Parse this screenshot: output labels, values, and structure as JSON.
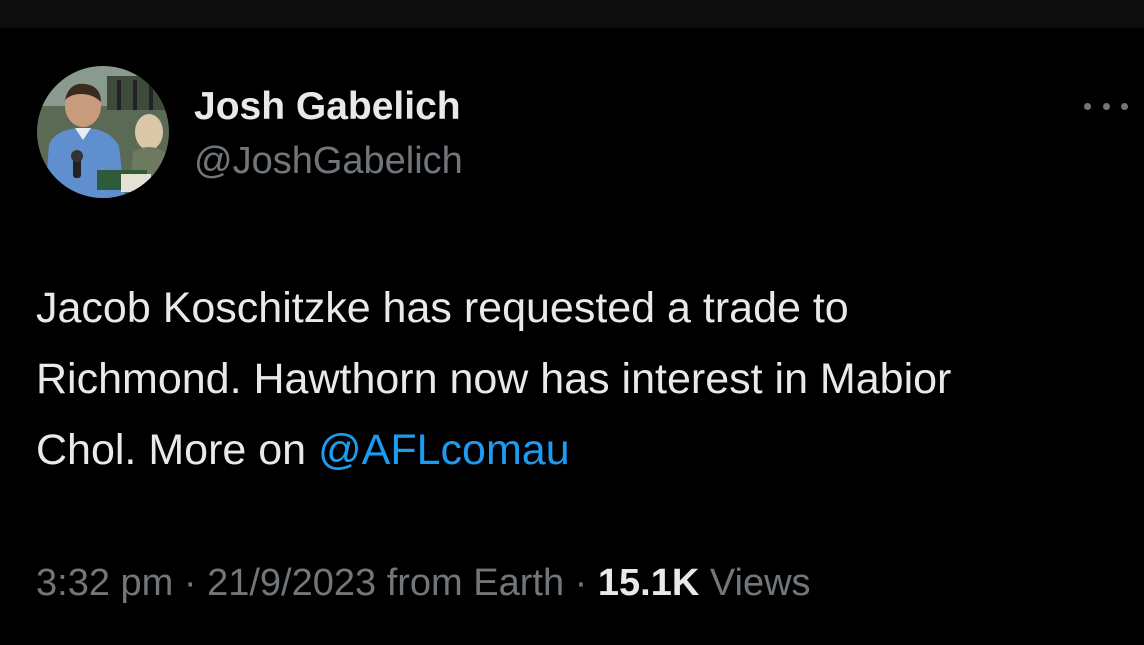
{
  "tweet": {
    "author": {
      "name": "Josh Gabelich",
      "handle": "@JoshGabelich"
    },
    "text": {
      "line1": "Jacob Koschitzke has requested a trade to",
      "line2": "Richmond. Hawthorn now has interest in Mabior",
      "line3_prefix": "Chol. More on ",
      "mention": "@AFLcomau"
    },
    "meta": {
      "time": "3:32 pm",
      "separator1": " · ",
      "date": "21/9/2023",
      "source": " from Earth",
      "separator2": " · ",
      "views_count": "15.1K",
      "views_label": " Views"
    }
  },
  "icons": {
    "more": "more-horizontal-icon",
    "avatar": "profile-photo"
  },
  "colors": {
    "background": "#000000",
    "primary_text": "#e7e9ea",
    "secondary_text": "#71767b",
    "link": "#1d9bf0"
  }
}
